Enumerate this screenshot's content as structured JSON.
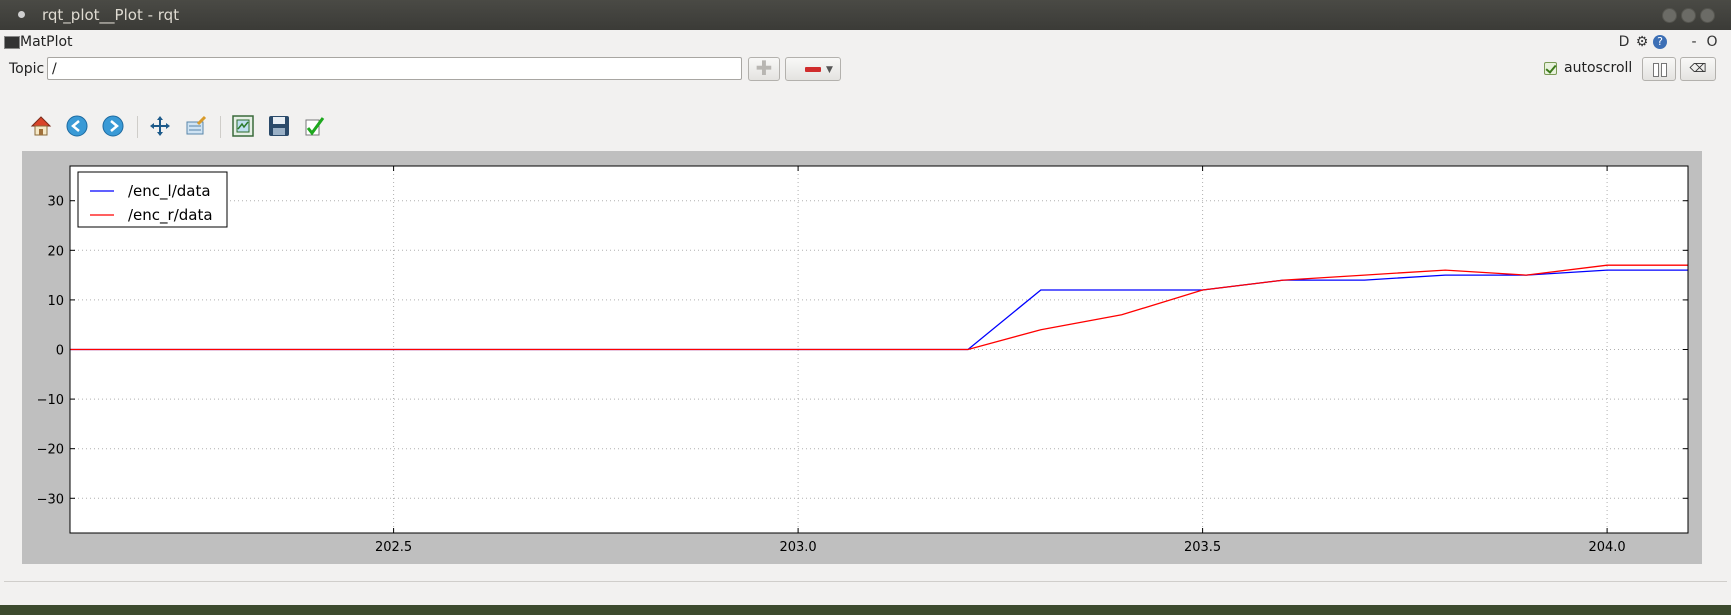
{
  "window": {
    "title": "rqt_plot__Plot - rqt"
  },
  "menubar": {
    "app_name": "MatPlot",
    "right_icons": [
      "D",
      "gear-icon",
      "?",
      "-",
      "O"
    ],
    "d_label": "D",
    "help_label": "?",
    "minimize_label": "-",
    "close_label": "O"
  },
  "topic_row": {
    "label": "Topic",
    "input_value": "/",
    "autoscroll_label": "autoscroll",
    "autoscroll_checked": true
  },
  "toolbar": {
    "icons": [
      "home-icon",
      "back-icon",
      "forward-icon",
      "pan-icon",
      "configure-subplots-icon",
      "zoom-icon",
      "save-icon",
      "edit-curves-icon"
    ]
  },
  "colors": {
    "series_blue": "#0000ff",
    "series_red": "#ff0000",
    "plot_bg": "#ffffff",
    "figure_bg": "#bfbfbf"
  },
  "chart_data": {
    "type": "line",
    "title": "",
    "xlabel": "",
    "ylabel": "",
    "xlim": [
      202.1,
      204.1
    ],
    "ylim": [
      -37,
      37
    ],
    "xticks": [
      202.5,
      203.0,
      203.5,
      204.0
    ],
    "xtick_labels": [
      "202.5",
      "203.0",
      "203.5",
      "204.0"
    ],
    "yticks": [
      30,
      20,
      10,
      0,
      -10,
      -20,
      -30
    ],
    "ytick_labels": [
      "30",
      "20",
      "10",
      "0",
      "−10",
      "−20",
      "−30"
    ],
    "grid": true,
    "legend_position": "top-left",
    "series": [
      {
        "name": "/enc_l/data",
        "color": "#0000ff",
        "x": [
          202.1,
          203.21,
          203.3,
          203.5,
          203.6,
          203.7,
          203.8,
          203.9,
          204.0,
          204.1
        ],
        "y": [
          0,
          0,
          12,
          12,
          14,
          14,
          15,
          15,
          16,
          16
        ]
      },
      {
        "name": "/enc_r/data",
        "color": "#ff0000",
        "x": [
          202.1,
          203.21,
          203.3,
          203.4,
          203.5,
          203.6,
          203.7,
          203.8,
          203.9,
          204.0,
          204.1
        ],
        "y": [
          0,
          0,
          4,
          7,
          12,
          14,
          15,
          16,
          15,
          17,
          17
        ]
      }
    ]
  }
}
